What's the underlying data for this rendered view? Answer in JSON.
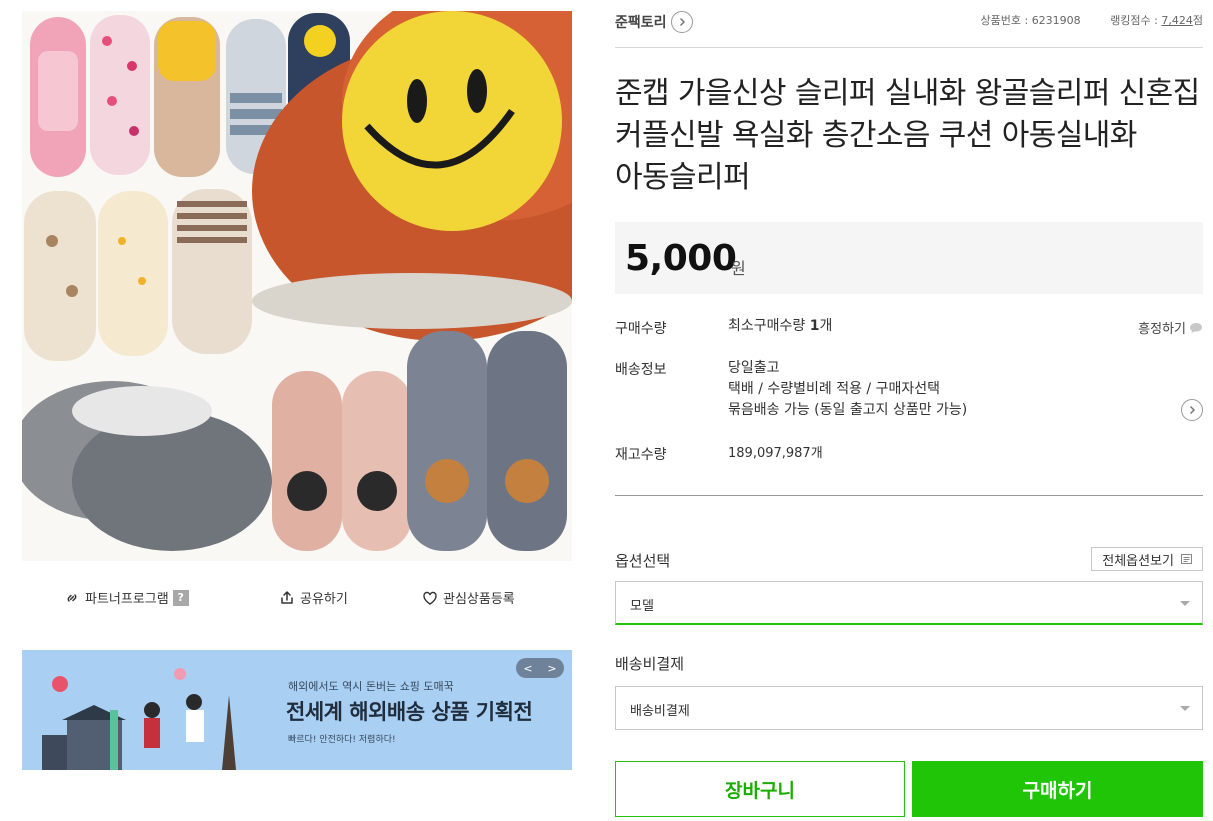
{
  "image_actions": {
    "partner": "파트너프로그램",
    "partner_help": "?",
    "share": "공유하기",
    "wishlist": "관심상품등록"
  },
  "banner": {
    "subtitle": "해외에서도 역시 돈버는 쇼핑 도매꾹",
    "title": "전세계 해외배송 상품 기획전",
    "note": "빠르다! 안전하다! 저렴하다!",
    "nav_prev": "<",
    "nav_next": ">"
  },
  "seller": {
    "name": "준팩토리"
  },
  "meta": {
    "product_no_label": "상품번호 : ",
    "product_no": "6231908",
    "ranking_label": "랭킹점수 : ",
    "ranking": "7,424",
    "ranking_unit": "점"
  },
  "product": {
    "title": "준캡 가을신상 슬리퍼 실내화 왕골슬리퍼 신혼집 커플신발 욕실화 층간소음 쿠션 아동실내화 아동슬리퍼",
    "price": "5,000",
    "price_unit": "원"
  },
  "info": {
    "qty_label": "구매수량",
    "qty_prefix": "최소구매수량 ",
    "qty_value": "1",
    "qty_suffix": "개",
    "haggle": "흥정하기",
    "ship_label": "배송정보",
    "ship_lines": [
      "당일출고",
      "택배 / 수량별비례 적용 / 구매자선택",
      "묶음배송 가능 (동일 출고지 상품만 가능)"
    ],
    "stock_label": "재고수량",
    "stock_value": "189,097,987개"
  },
  "options": {
    "label": "옵션선택",
    "all_options": "전체옵션보기",
    "selected": "모델",
    "ship_pay_label": "배송비결제",
    "ship_pay_selected": "배송비결제"
  },
  "actions": {
    "cart": "장바구니",
    "buy": "구매하기"
  },
  "colors": {
    "accent": "#1fc506",
    "price_bg": "#f5f5f5",
    "banner_bg": "#a9cff3"
  }
}
